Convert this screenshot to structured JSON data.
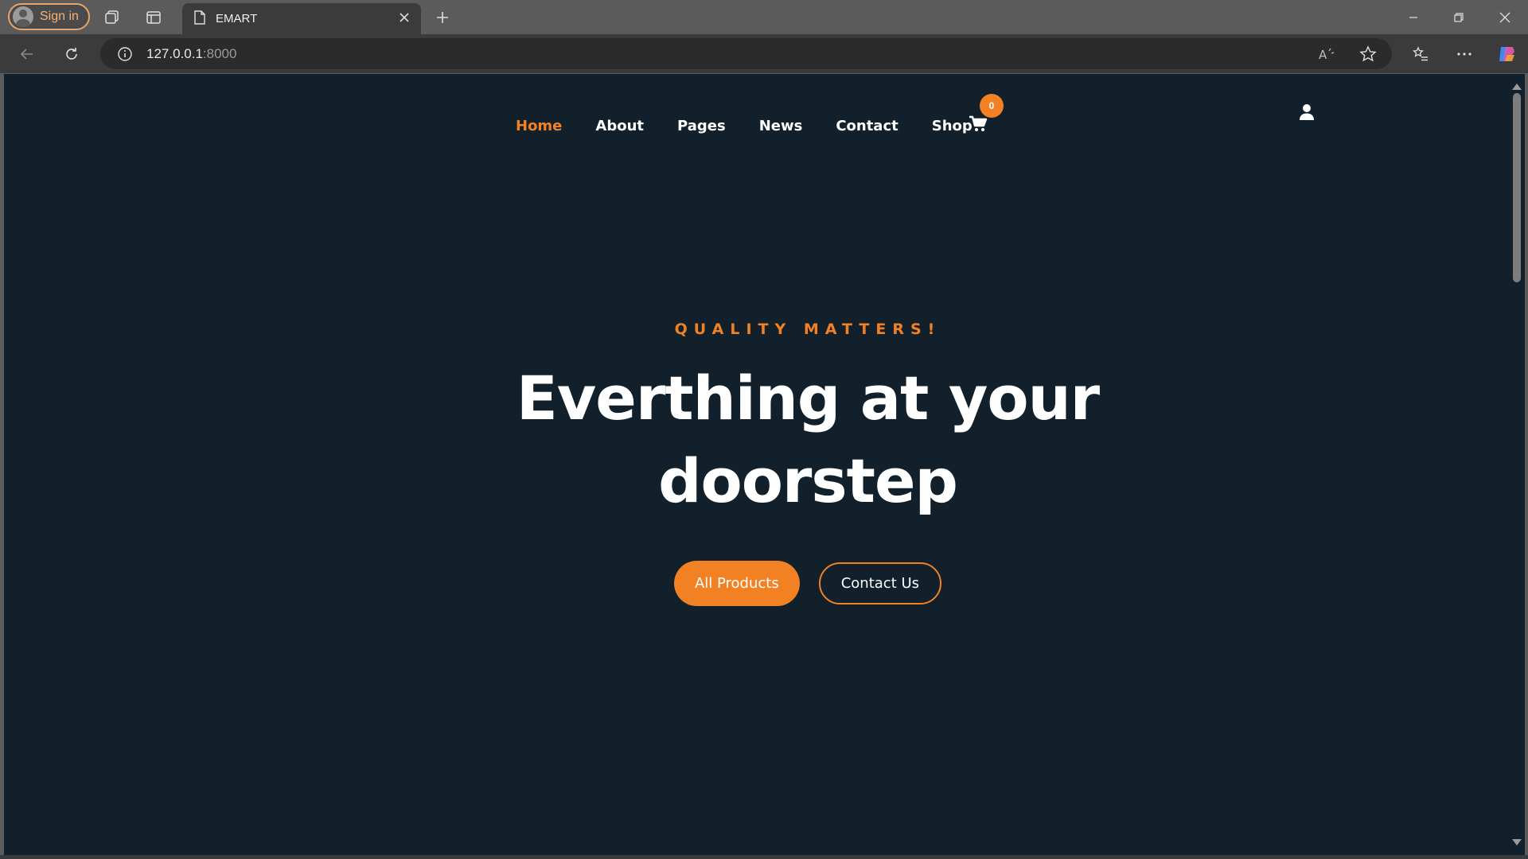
{
  "browser": {
    "signin_label": "Sign in",
    "tab_title": "EMART",
    "url_host": "127.0.0.1",
    "url_port": ":8000",
    "accent_color": "#f28123"
  },
  "site": {
    "nav": [
      {
        "label": "Home",
        "active": true
      },
      {
        "label": "About"
      },
      {
        "label": "Pages"
      },
      {
        "label": "News"
      },
      {
        "label": "Contact"
      },
      {
        "label": "Shop"
      }
    ],
    "cart_count": "0",
    "hero": {
      "subtitle": "QUALITY MATTERS!",
      "headline_line1": "Everthing at your",
      "headline_line2": "doorstep",
      "primary_button": "All Products",
      "secondary_button": "Contact Us"
    },
    "background_color": "#11202a"
  }
}
